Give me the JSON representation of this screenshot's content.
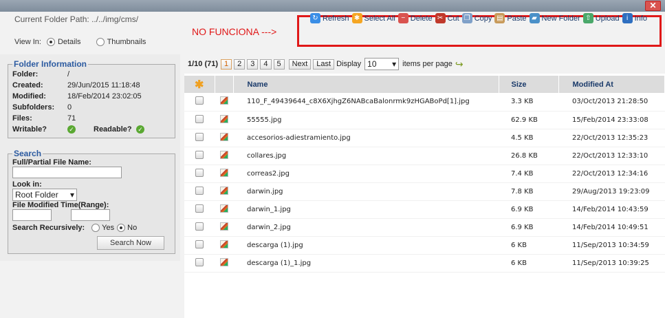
{
  "window": {
    "close_label": "✕"
  },
  "top": {
    "path_label": "Current Folder Path:",
    "path_value": "../../img/cms/",
    "view_in_label": "View In:",
    "view_details": "Details",
    "view_thumbnails": "Thumbnails",
    "note": "NO FUNCIONA --->"
  },
  "toolbar": [
    {
      "label": "Refresh",
      "icon": "refresh-icon",
      "color": "#3a8ee6",
      "glyph": "↻"
    },
    {
      "label": "Select All",
      "icon": "select-all-icon",
      "color": "#f5a623",
      "glyph": "✱"
    },
    {
      "label": "Delete",
      "icon": "delete-icon",
      "color": "#d9534f",
      "glyph": "−"
    },
    {
      "label": "Cut",
      "icon": "cut-icon",
      "color": "#c0392b",
      "glyph": "✂"
    },
    {
      "label": "Copy",
      "icon": "copy-icon",
      "color": "#7fa0c8",
      "glyph": "❐"
    },
    {
      "label": "Paste",
      "icon": "paste-icon",
      "color": "#c89a5a",
      "glyph": "▤"
    },
    {
      "label": "New Folder",
      "icon": "new-folder-icon",
      "color": "#4a90c8",
      "glyph": "▰"
    },
    {
      "label": "Upload",
      "icon": "upload-icon",
      "color": "#4aa86a",
      "glyph": "⇧"
    },
    {
      "label": "Info",
      "icon": "info-icon",
      "color": "#2f6fc0",
      "glyph": "i"
    }
  ],
  "folder_info": {
    "title": "Folder Information",
    "folder_label": "Folder:",
    "folder_value": "/",
    "created_label": "Created:",
    "created_value": "29/Jun/2015 11:18:48",
    "modified_label": "Modified:",
    "modified_value": "18/Feb/2014 23:02:05",
    "subfolders_label": "Subfolders:",
    "subfolders_value": "0",
    "files_label": "Files:",
    "files_value": "71",
    "writable_label": "Writable?",
    "readable_label": "Readable?"
  },
  "search": {
    "title": "Search",
    "name_label": "Full/Partial File Name:",
    "look_in_label": "Look in:",
    "look_in_value": "Root Folder",
    "modified_label": "File Modified Time(Range):",
    "recursive_label": "Search Recursively:",
    "yes": "Yes",
    "no": "No",
    "button": "Search Now"
  },
  "pager": {
    "summary": "1/10 (71)",
    "pages": [
      "1",
      "2",
      "3",
      "4",
      "5"
    ],
    "next": "Next",
    "last": "Last",
    "display_label": "Display",
    "display_value": "10",
    "per_page_label": "items per page"
  },
  "table": {
    "headers": {
      "name": "Name",
      "size": "Size",
      "modified": "Modified At"
    },
    "rows": [
      {
        "name": "110_F_49439644_c8X6XjhgZ6NABcaBalonrmk9zHGABoPd[1].jpg",
        "size": "3.3 KB",
        "modified": "03/Oct/2013 21:28:50"
      },
      {
        "name": "55555.jpg",
        "size": "62.9 KB",
        "modified": "15/Feb/2014 23:33:08"
      },
      {
        "name": "accesorios-adiestramiento.jpg",
        "size": "4.5 KB",
        "modified": "22/Oct/2013 12:35:23"
      },
      {
        "name": "collares.jpg",
        "size": "26.8 KB",
        "modified": "22/Oct/2013 12:33:10"
      },
      {
        "name": "correas2.jpg",
        "size": "7.4 KB",
        "modified": "22/Oct/2013 12:34:16"
      },
      {
        "name": "darwin.jpg",
        "size": "7.8 KB",
        "modified": "29/Aug/2013 19:23:09"
      },
      {
        "name": "darwin_1.jpg",
        "size": "6.9 KB",
        "modified": "14/Feb/2014 10:43:59"
      },
      {
        "name": "darwin_2.jpg",
        "size": "6.9 KB",
        "modified": "14/Feb/2014 10:49:51"
      },
      {
        "name": "descarga (1).jpg",
        "size": "6 KB",
        "modified": "11/Sep/2013 10:34:59"
      },
      {
        "name": "descarga (1)_1.jpg",
        "size": "6 KB",
        "modified": "11/Sep/2013 10:39:25"
      }
    ]
  }
}
